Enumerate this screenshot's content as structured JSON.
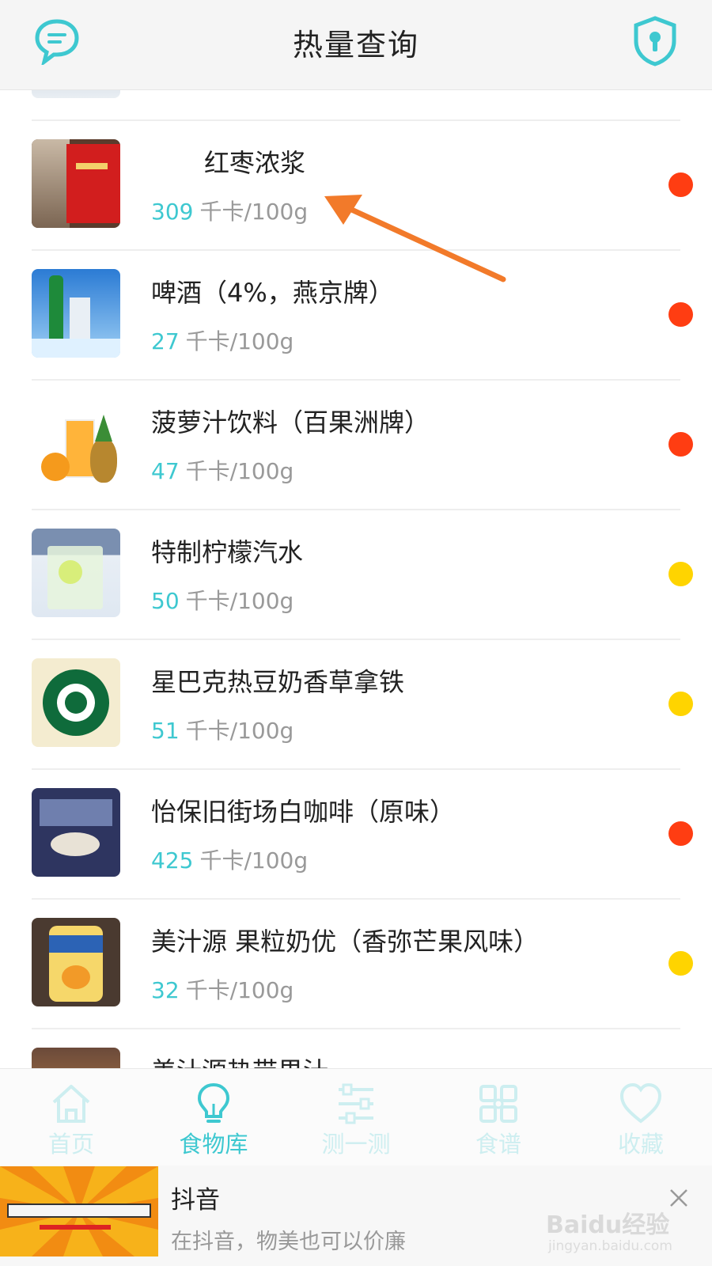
{
  "header": {
    "title": "热量查询"
  },
  "items": [
    {
      "name": "",
      "kcal": "",
      "unit": "",
      "dot": ""
    },
    {
      "name": "红枣浓浆",
      "kcal": "309",
      "unit": "千卡/100g",
      "dot": "red"
    },
    {
      "name": "啤酒（4%，燕京牌）",
      "kcal": "27",
      "unit": "千卡/100g",
      "dot": "red"
    },
    {
      "name": "菠萝汁饮料（百果洲牌）",
      "kcal": "47",
      "unit": "千卡/100g",
      "dot": "red"
    },
    {
      "name": "特制柠檬汽水",
      "kcal": "50",
      "unit": "千卡/100g",
      "dot": "yellow"
    },
    {
      "name": "星巴克热豆奶香草拿铁",
      "kcal": "51",
      "unit": "千卡/100g",
      "dot": "yellow"
    },
    {
      "name": "怡保旧街场白咖啡（原味）",
      "kcal": "425",
      "unit": "千卡/100g",
      "dot": "red"
    },
    {
      "name": "美汁源 果粒奶优（香弥芒果风味）",
      "kcal": "32",
      "unit": "千卡/100g",
      "dot": "yellow"
    },
    {
      "name": "美汁源热带果汁",
      "kcal": "",
      "unit": "",
      "dot": ""
    }
  ],
  "tabs": [
    {
      "label": "首页",
      "icon": "home-icon",
      "active": false
    },
    {
      "label": "食物库",
      "icon": "lightbulb-icon",
      "active": true
    },
    {
      "label": "测一测",
      "icon": "sliders-icon",
      "active": false
    },
    {
      "label": "食谱",
      "icon": "grid-icon",
      "active": false
    },
    {
      "label": "收藏",
      "icon": "heart-icon",
      "active": false
    }
  ],
  "ad": {
    "title": "抖音",
    "subtitle": "在抖音，物美也可以价廉",
    "watermark": "Baidu经验",
    "watermark_url": "jingyan.baidu.com"
  },
  "colors": {
    "accent": "#3ec8d0",
    "dot_red": "#ff3d12",
    "dot_yellow": "#ffd400",
    "arrow": "#f27a2a"
  }
}
